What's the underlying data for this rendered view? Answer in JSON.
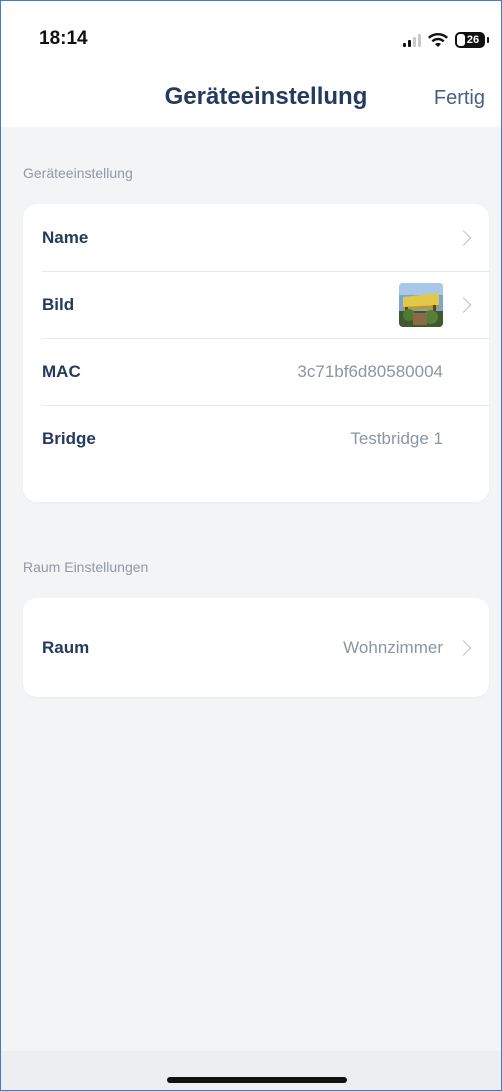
{
  "status_bar": {
    "time": "18:14",
    "battery_level": "26",
    "icons": [
      "cellular-signal-icon",
      "wifi-icon",
      "battery-icon"
    ]
  },
  "nav": {
    "title": "Geräteeinstellung",
    "done_label": "Fertig"
  },
  "sections": [
    {
      "label": "Geräteeinstellung",
      "rows": [
        {
          "label": "Name",
          "value": "",
          "chevron": true
        },
        {
          "label": "Bild",
          "value": "",
          "chevron": true,
          "thumbnail": "device-photo"
        },
        {
          "label": "MAC",
          "value": "3c71bf6d80580004",
          "chevron": false
        },
        {
          "label": "Bridge",
          "value": "Testbridge 1",
          "chevron": false
        }
      ]
    },
    {
      "label": "Raum Einstellungen",
      "rows": [
        {
          "label": "Raum",
          "value": "Wohnzimmer",
          "chevron": true
        }
      ]
    }
  ],
  "colors": {
    "title": "#253a5e",
    "secondary_text": "#8c95a3",
    "background": "#f3f4f6",
    "card": "#ffffff",
    "border_accent": "#3d7ec6"
  }
}
